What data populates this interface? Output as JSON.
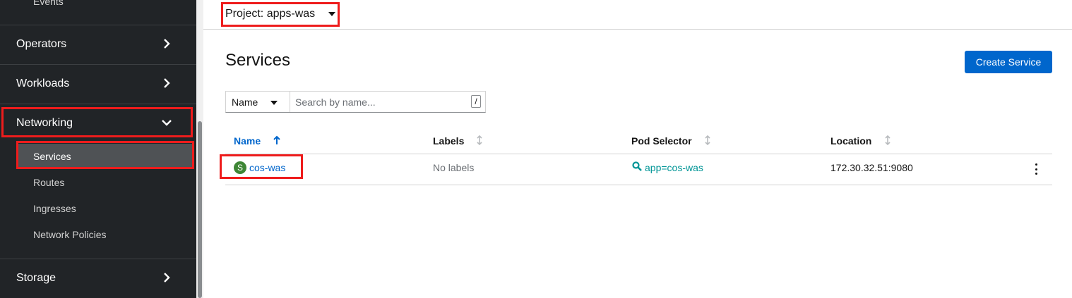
{
  "sidebar": {
    "partial_top_item": "Events",
    "sections": [
      {
        "label": "Operators"
      },
      {
        "label": "Workloads"
      },
      {
        "label": "Networking",
        "expanded": true
      },
      {
        "label": "Storage"
      }
    ],
    "networking_items": [
      "Services",
      "Routes",
      "Ingresses",
      "Network Policies"
    ],
    "active_item": "Services"
  },
  "header": {
    "project_label": "Project: apps-was"
  },
  "page": {
    "title": "Services",
    "create_button": "Create Service"
  },
  "filter": {
    "type": "Name",
    "placeholder": "Search by name...",
    "shortcut": "/"
  },
  "table": {
    "columns": [
      "Name",
      "Labels",
      "Pod Selector",
      "Location"
    ],
    "sorted_column": "Name",
    "rows": [
      {
        "badge": "S",
        "name": "cos-was",
        "labels": "No labels",
        "pod_selector": "app=cos-was",
        "location": "172.30.32.51:9080"
      }
    ]
  },
  "colors": {
    "accent": "#0066cc",
    "highlight": "#ee1c1c",
    "badge": "#3e8635",
    "link_teal": "#009596",
    "sidebar_bg": "#212427"
  }
}
